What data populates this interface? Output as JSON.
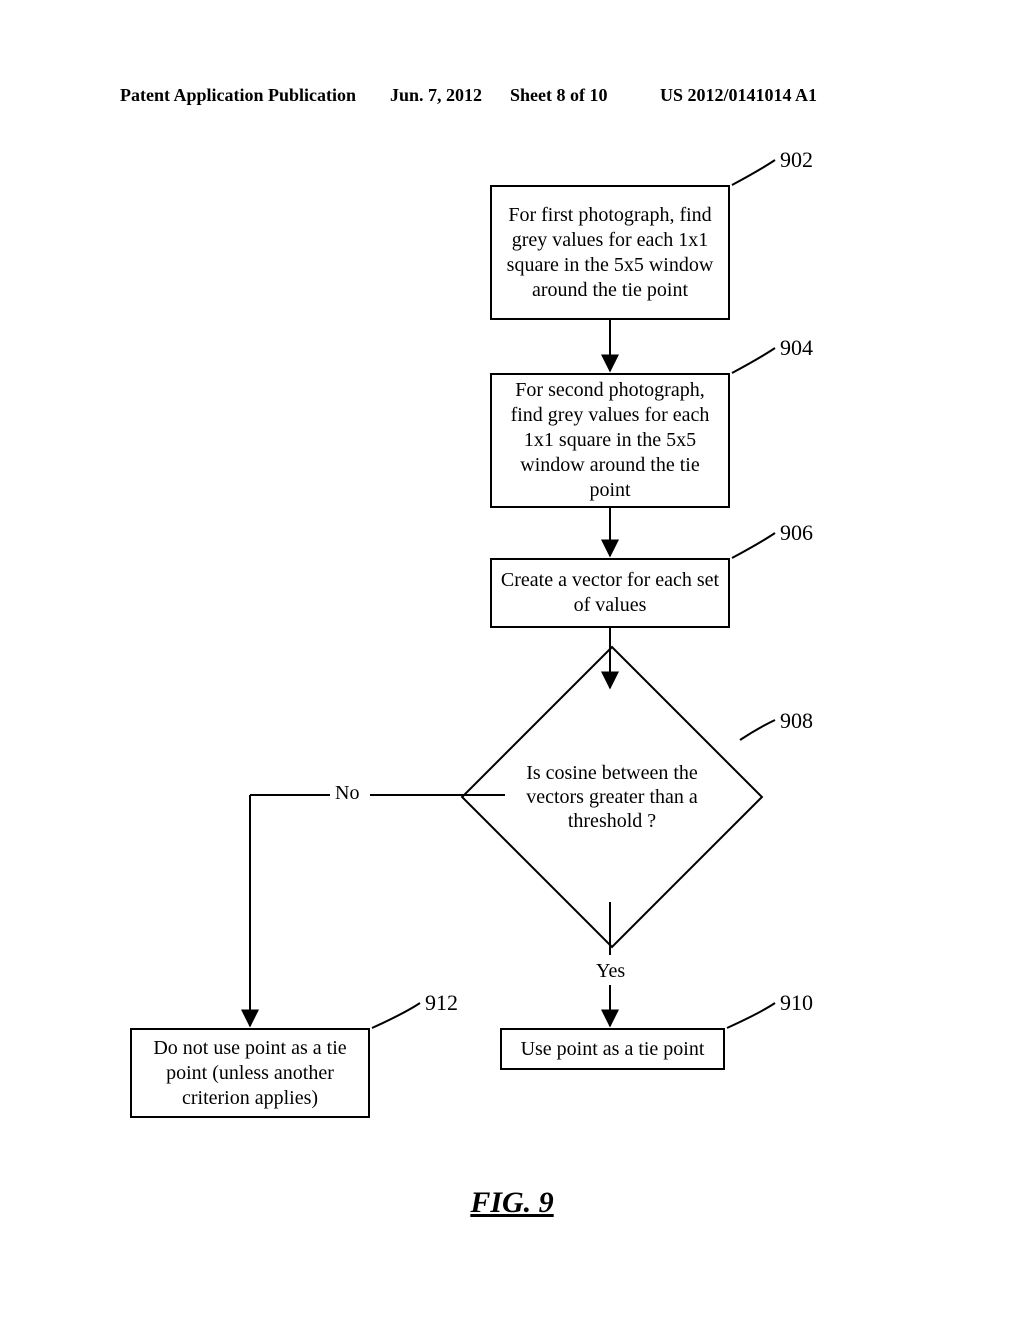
{
  "header": {
    "left": "Patent Application Publication",
    "date": "Jun. 7, 2012",
    "sheet": "Sheet 8 of 10",
    "pubno": "US 2012/0141014 A1"
  },
  "nodes": {
    "n902": "For first photograph, find grey values for each 1x1 square in the 5x5 window around the tie point",
    "n904": "For second photograph, find grey values for each 1x1 square in the 5x5 window around the tie point",
    "n906": "Create a vector for each set of values",
    "n908": "Is cosine between the vectors greater than a threshold ?",
    "n910": "Use point as a tie point",
    "n912": "Do not use point as a tie point (unless another criterion applies)"
  },
  "refs": {
    "r902": "902",
    "r904": "904",
    "r906": "906",
    "r908": "908",
    "r910": "910",
    "r912": "912"
  },
  "edges": {
    "yes": "Yes",
    "no": "No"
  },
  "figure": "FIG. 9",
  "chart_data": {
    "type": "flowchart",
    "nodes": [
      {
        "id": "902",
        "kind": "process",
        "text": "For first photograph, find grey values for each 1x1 square in the 5x5 window around the tie point"
      },
      {
        "id": "904",
        "kind": "process",
        "text": "For second photograph, find grey values for each 1x1 square in the 5x5 window around the tie point"
      },
      {
        "id": "906",
        "kind": "process",
        "text": "Create a vector for each set of values"
      },
      {
        "id": "908",
        "kind": "decision",
        "text": "Is cosine between the vectors greater than a threshold?"
      },
      {
        "id": "910",
        "kind": "process",
        "text": "Use point as a tie point"
      },
      {
        "id": "912",
        "kind": "process",
        "text": "Do not use point as a tie point (unless another criterion applies)"
      }
    ],
    "edges": [
      {
        "from": "902",
        "to": "904"
      },
      {
        "from": "904",
        "to": "906"
      },
      {
        "from": "906",
        "to": "908"
      },
      {
        "from": "908",
        "to": "910",
        "label": "Yes"
      },
      {
        "from": "908",
        "to": "912",
        "label": "No"
      }
    ]
  }
}
